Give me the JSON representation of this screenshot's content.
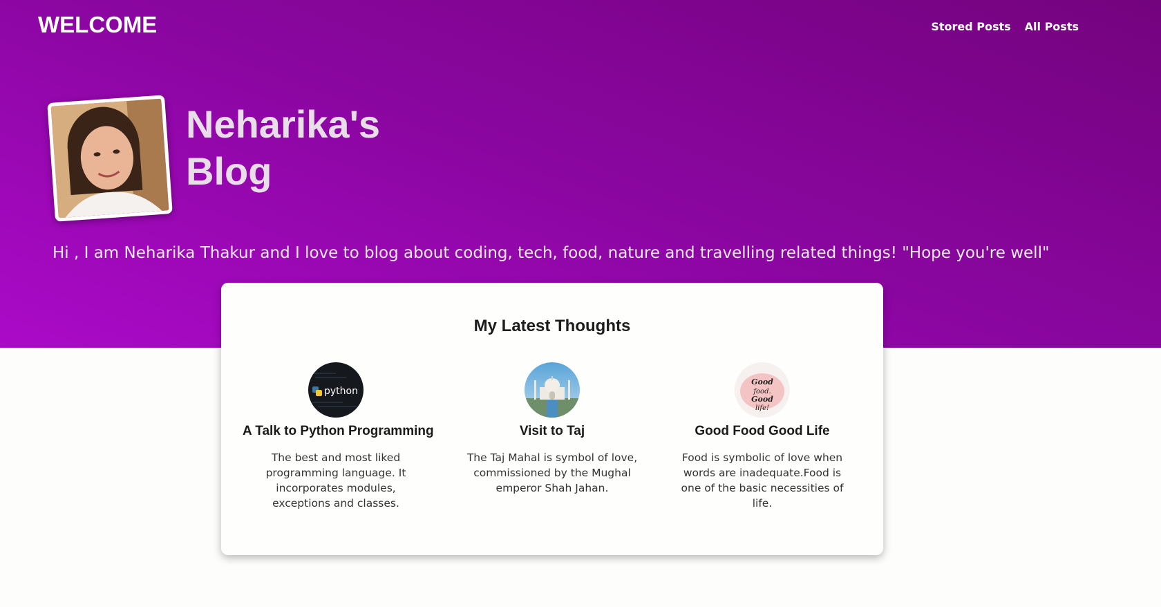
{
  "header": {
    "brand": "WELCOME",
    "nav": [
      {
        "label": "Stored Posts"
      },
      {
        "label": "All Posts"
      }
    ]
  },
  "hero": {
    "title_line1": "Neharika's",
    "title_line2": "Blog",
    "intro": "Hi , I am Neharika Thakur and I love to blog about coding, tech, food, nature and travelling related things! \"Hope you're well\""
  },
  "latest": {
    "heading": "My Latest Thoughts",
    "posts": [
      {
        "title": "A Talk to Python Programming",
        "description": "The best and most liked programming language. It incorporates modules, exceptions and classes.",
        "thumb_text": "python",
        "icon": "python-logo-icon"
      },
      {
        "title": "Visit to Taj",
        "description": "The Taj Mahal is symbol of love, commissioned by the Mughal emperor Shah Jahan.",
        "icon": "taj-mahal-icon"
      },
      {
        "title": "Good Food Good Life",
        "description": "Food is symbolic of love when words are inadequate.Food is one of the basic necessities of life.",
        "thumb_text": "Good food. Good life!",
        "icon": "good-food-lettering-icon"
      }
    ]
  },
  "colors": {
    "hero_gradient_start": "#74037e",
    "hero_gradient_end": "#ab0ac8",
    "page_background": "#fdfdfb",
    "card_background": "#fefefd"
  }
}
